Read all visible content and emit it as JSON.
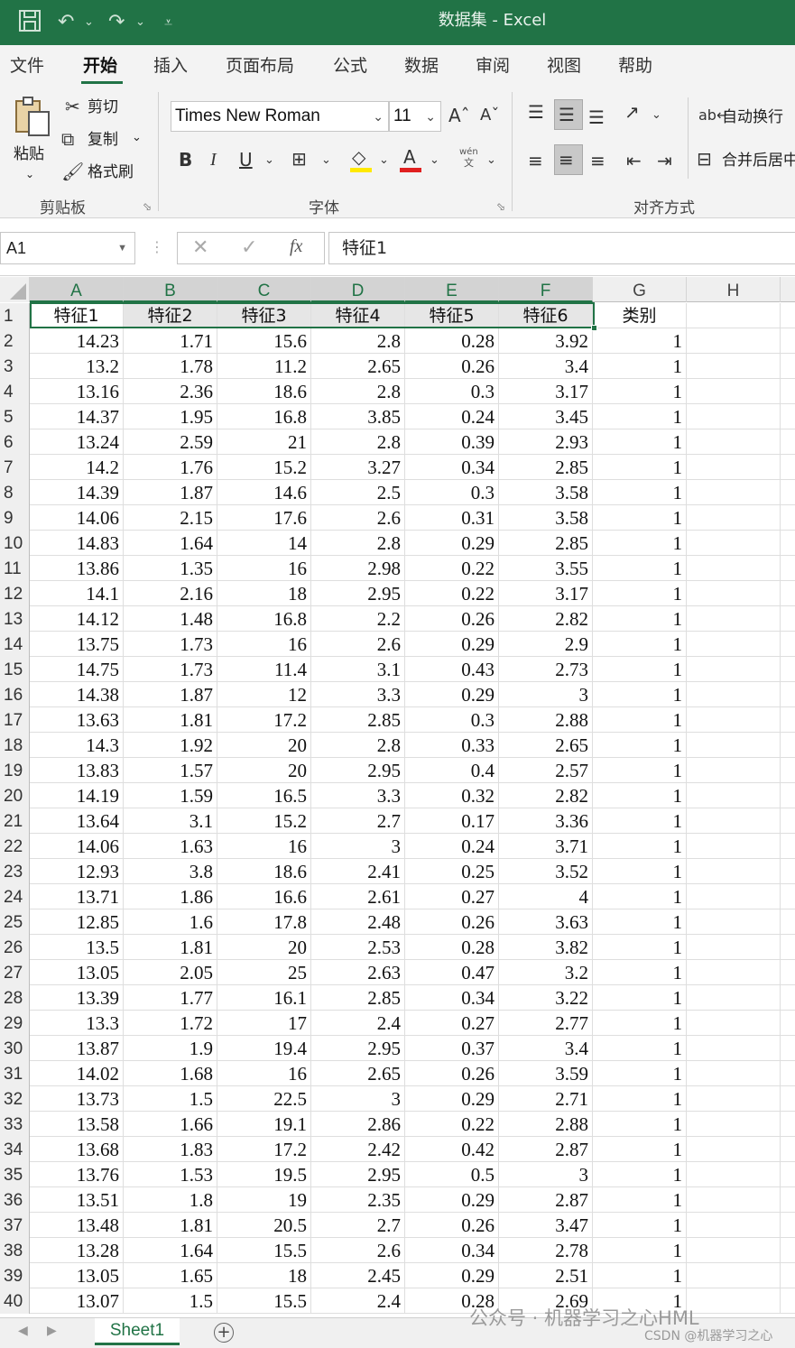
{
  "window": {
    "title": "数据集  -  Excel"
  },
  "menu": {
    "tabs": [
      "文件",
      "开始",
      "插入",
      "页面布局",
      "公式",
      "数据",
      "审阅",
      "视图",
      "帮助"
    ]
  },
  "ribbon": {
    "clipboard": {
      "paste": "粘贴",
      "cut": "剪切",
      "copy": "复制",
      "format_painter": "格式刷",
      "group": "剪贴板"
    },
    "font": {
      "name": "Times New Roman",
      "size": "11",
      "bold": "B",
      "italic": "I",
      "underline": "U",
      "font_color": "A",
      "phonetic": "wén",
      "phonetic_char": "文",
      "group": "字体"
    },
    "alignment": {
      "wrap_text": "自动换行",
      "merge_center": "合并后居中",
      "group": "对齐方式"
    }
  },
  "formula_bar": {
    "name_box": "A1",
    "formula": "特征1",
    "fx": "fx"
  },
  "grid": {
    "columns": [
      "A",
      "B",
      "C",
      "D",
      "E",
      "F",
      "G",
      "H"
    ],
    "rows": [
      [
        "特征1",
        "特征2",
        "特征3",
        "特征4",
        "特征5",
        "特征6",
        "类别"
      ],
      [
        "14.23",
        "1.71",
        "15.6",
        "2.8",
        "0.28",
        "3.92",
        "1"
      ],
      [
        "13.2",
        "1.78",
        "11.2",
        "2.65",
        "0.26",
        "3.4",
        "1"
      ],
      [
        "13.16",
        "2.36",
        "18.6",
        "2.8",
        "0.3",
        "3.17",
        "1"
      ],
      [
        "14.37",
        "1.95",
        "16.8",
        "3.85",
        "0.24",
        "3.45",
        "1"
      ],
      [
        "13.24",
        "2.59",
        "21",
        "2.8",
        "0.39",
        "2.93",
        "1"
      ],
      [
        "14.2",
        "1.76",
        "15.2",
        "3.27",
        "0.34",
        "2.85",
        "1"
      ],
      [
        "14.39",
        "1.87",
        "14.6",
        "2.5",
        "0.3",
        "3.58",
        "1"
      ],
      [
        "14.06",
        "2.15",
        "17.6",
        "2.6",
        "0.31",
        "3.58",
        "1"
      ],
      [
        "14.83",
        "1.64",
        "14",
        "2.8",
        "0.29",
        "2.85",
        "1"
      ],
      [
        "13.86",
        "1.35",
        "16",
        "2.98",
        "0.22",
        "3.55",
        "1"
      ],
      [
        "14.1",
        "2.16",
        "18",
        "2.95",
        "0.22",
        "3.17",
        "1"
      ],
      [
        "14.12",
        "1.48",
        "16.8",
        "2.2",
        "0.26",
        "2.82",
        "1"
      ],
      [
        "13.75",
        "1.73",
        "16",
        "2.6",
        "0.29",
        "2.9",
        "1"
      ],
      [
        "14.75",
        "1.73",
        "11.4",
        "3.1",
        "0.43",
        "2.73",
        "1"
      ],
      [
        "14.38",
        "1.87",
        "12",
        "3.3",
        "0.29",
        "3",
        "1"
      ],
      [
        "13.63",
        "1.81",
        "17.2",
        "2.85",
        "0.3",
        "2.88",
        "1"
      ],
      [
        "14.3",
        "1.92",
        "20",
        "2.8",
        "0.33",
        "2.65",
        "1"
      ],
      [
        "13.83",
        "1.57",
        "20",
        "2.95",
        "0.4",
        "2.57",
        "1"
      ],
      [
        "14.19",
        "1.59",
        "16.5",
        "3.3",
        "0.32",
        "2.82",
        "1"
      ],
      [
        "13.64",
        "3.1",
        "15.2",
        "2.7",
        "0.17",
        "3.36",
        "1"
      ],
      [
        "14.06",
        "1.63",
        "16",
        "3",
        "0.24",
        "3.71",
        "1"
      ],
      [
        "12.93",
        "3.8",
        "18.6",
        "2.41",
        "0.25",
        "3.52",
        "1"
      ],
      [
        "13.71",
        "1.86",
        "16.6",
        "2.61",
        "0.27",
        "4",
        "1"
      ],
      [
        "12.85",
        "1.6",
        "17.8",
        "2.48",
        "0.26",
        "3.63",
        "1"
      ],
      [
        "13.5",
        "1.81",
        "20",
        "2.53",
        "0.28",
        "3.82",
        "1"
      ],
      [
        "13.05",
        "2.05",
        "25",
        "2.63",
        "0.47",
        "3.2",
        "1"
      ],
      [
        "13.39",
        "1.77",
        "16.1",
        "2.85",
        "0.34",
        "3.22",
        "1"
      ],
      [
        "13.3",
        "1.72",
        "17",
        "2.4",
        "0.27",
        "2.77",
        "1"
      ],
      [
        "13.87",
        "1.9",
        "19.4",
        "2.95",
        "0.37",
        "3.4",
        "1"
      ],
      [
        "14.02",
        "1.68",
        "16",
        "2.65",
        "0.26",
        "3.59",
        "1"
      ],
      [
        "13.73",
        "1.5",
        "22.5",
        "3",
        "0.29",
        "2.71",
        "1"
      ],
      [
        "13.58",
        "1.66",
        "19.1",
        "2.86",
        "0.22",
        "2.88",
        "1"
      ],
      [
        "13.68",
        "1.83",
        "17.2",
        "2.42",
        "0.42",
        "2.87",
        "1"
      ],
      [
        "13.76",
        "1.53",
        "19.5",
        "2.95",
        "0.5",
        "3",
        "1"
      ],
      [
        "13.51",
        "1.8",
        "19",
        "2.35",
        "0.29",
        "2.87",
        "1"
      ],
      [
        "13.48",
        "1.81",
        "20.5",
        "2.7",
        "0.26",
        "3.47",
        "1"
      ],
      [
        "13.28",
        "1.64",
        "15.5",
        "2.6",
        "0.34",
        "2.78",
        "1"
      ],
      [
        "13.05",
        "1.65",
        "18",
        "2.45",
        "0.29",
        "2.51",
        "1"
      ],
      [
        "13.07",
        "1.5",
        "15.5",
        "2.4",
        "0.28",
        "2.69",
        "1"
      ]
    ]
  },
  "sheet_tabs": {
    "active": "Sheet1"
  },
  "watermark": {
    "line1": "公众号 · 机器学习之心HML",
    "line2": "CSDN @机器学习之心"
  },
  "colors": {
    "accent": "#217346"
  }
}
